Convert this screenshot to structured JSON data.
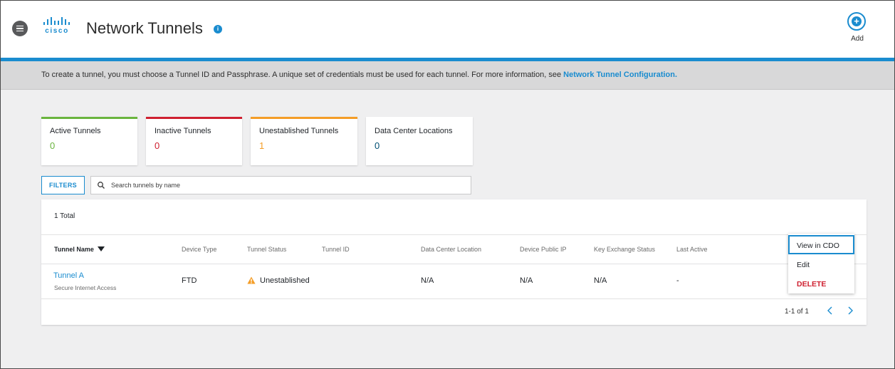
{
  "header": {
    "logo_text": "cisco",
    "title": "Network Tunnels",
    "info_glyph": "i",
    "add_label": "Add",
    "add_glyph": "+"
  },
  "banner": {
    "text": "To create a tunnel, you must choose a Tunnel ID and Passphrase. A unique set of credentials must be used for each tunnel. For more information, see ",
    "link": "Network Tunnel Configuration."
  },
  "stats": [
    {
      "label": "Active Tunnels",
      "value": "0",
      "color": "#6ab43e"
    },
    {
      "label": "Inactive Tunnels",
      "value": "0",
      "color": "#cf2030"
    },
    {
      "label": "Unestablished Tunnels",
      "value": "1",
      "color": "#f49d27"
    },
    {
      "label": "Data Center Locations",
      "value": "0",
      "color": "#005073"
    }
  ],
  "filters": {
    "label": "FILTERS",
    "search_placeholder": "Search tunnels by name",
    "search_value": ""
  },
  "table": {
    "total": "1 Total",
    "columns": [
      "Tunnel Name",
      "Device Type",
      "Tunnel Status",
      "Tunnel ID",
      "Data Center Location",
      "Device Public IP",
      "Key Exchange Status",
      "Last Active"
    ],
    "rows": [
      {
        "name": "Tunnel A",
        "sub": "Secure Internet Access",
        "device_type": "FTD",
        "status": "Unestablished",
        "tunnel_id": "",
        "dc_location": "N/A",
        "public_ip": "N/A",
        "key_exchange": "N/A",
        "last_active": "-"
      }
    ],
    "pagination": "1-1 of 1"
  },
  "row_menu": {
    "items": [
      "View in CDO",
      "Edit",
      "DELETE"
    ]
  },
  "colors": {
    "accent": "#1a8ccf",
    "danger": "#cf2030",
    "warning": "#f49d27"
  }
}
